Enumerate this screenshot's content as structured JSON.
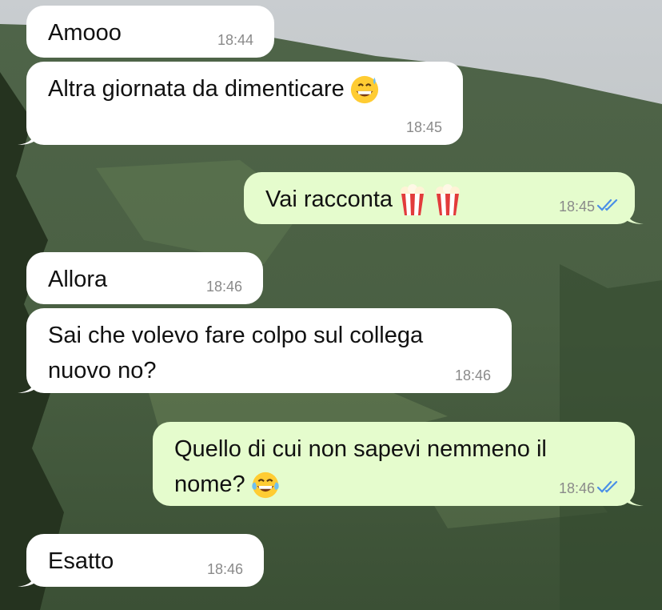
{
  "messages": [
    {
      "id": "m1",
      "direction": "incoming",
      "text": "Amooo",
      "time": "18:44"
    },
    {
      "id": "m2",
      "direction": "incoming",
      "text": "Altra giornata da dimenticare",
      "emoji": [
        "grinning-sweat-emoji"
      ],
      "time": "18:45"
    },
    {
      "id": "m3",
      "direction": "outgoing",
      "text": "Vai racconta",
      "emoji": [
        "popcorn-emoji",
        "popcorn-emoji"
      ],
      "time": "18:45",
      "status": "read"
    },
    {
      "id": "m4",
      "direction": "incoming",
      "text": "Allora",
      "time": "18:46"
    },
    {
      "id": "m5",
      "direction": "incoming",
      "line1": "Sai che volevo fare colpo sul collega",
      "line2": "nuovo no?",
      "time": "18:46"
    },
    {
      "id": "m6",
      "direction": "outgoing",
      "line1": "Quello di cui non sapevi nemmeno il",
      "line2": "nome?",
      "emoji": [
        "tears-of-joy-emoji"
      ],
      "time": "18:46",
      "status": "read"
    },
    {
      "id": "m7",
      "direction": "incoming",
      "text": "Esatto",
      "time": "18:46"
    }
  ],
  "colors": {
    "incoming_bubble": "#ffffff",
    "outgoing_bubble": "#e5fccd",
    "timestamp": "#8a8a8a",
    "read_ticks": "#4a8fe7"
  },
  "wallpaper": "forest-mountain-photo"
}
